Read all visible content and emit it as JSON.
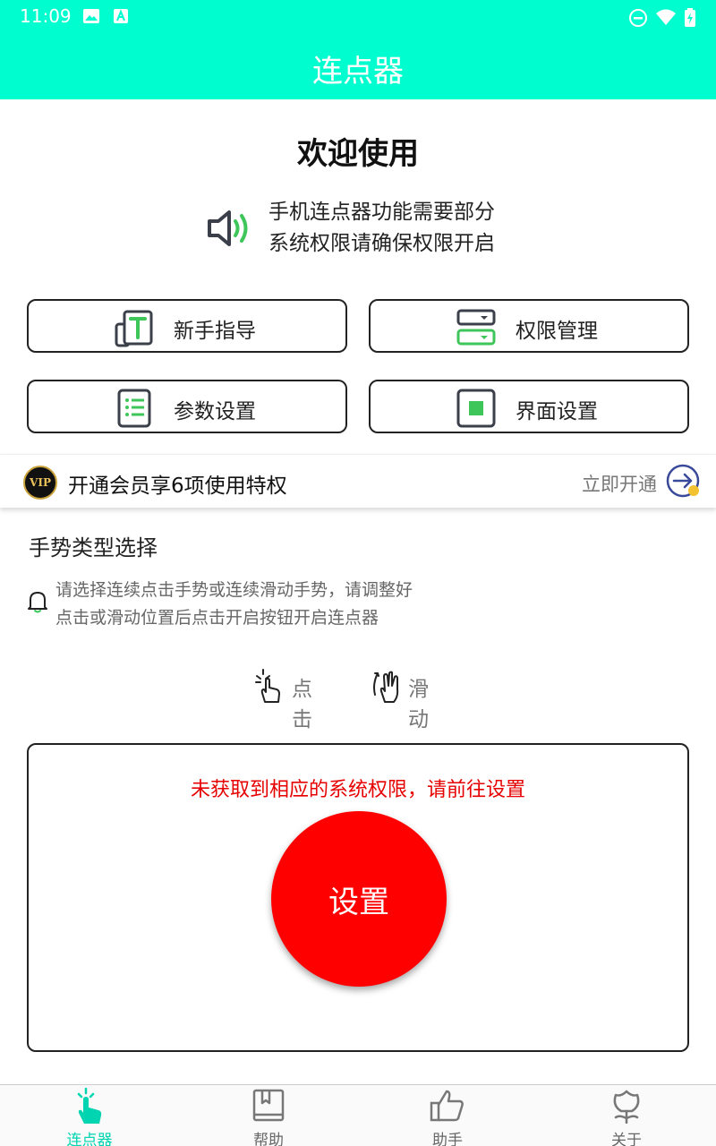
{
  "status_bar": {
    "time": "11:09"
  },
  "header": {
    "title": "连点器"
  },
  "welcome": {
    "title": "欢迎使用",
    "line1": "手机连点器功能需要部分",
    "line2": "系统权限请确保权限开启"
  },
  "functions": [
    {
      "label": "新手指导",
      "icon": "beginner-guide-icon"
    },
    {
      "label": "权限管理",
      "icon": "permission-manage-icon"
    },
    {
      "label": "参数设置",
      "icon": "parameter-settings-icon"
    },
    {
      "label": "界面设置",
      "icon": "interface-settings-icon"
    }
  ],
  "vip": {
    "badge": "VIP",
    "text": "开通会员享6项使用特权",
    "action": "立即开通"
  },
  "gesture": {
    "title": "手势类型选择",
    "tip_line1": "请选择连续点击手势或连续滑动手势，请调整好",
    "tip_line2": "点击或滑动位置后点击开启按钮开启连点器",
    "options": [
      {
        "label": "点击",
        "icon": "tap-hand-icon"
      },
      {
        "label": "滑动",
        "icon": "swipe-hand-icon"
      }
    ]
  },
  "panel": {
    "warning": "未获取到相应的系统权限，请前往设置",
    "button": "设置"
  },
  "bottom_nav": [
    {
      "label": "连点器",
      "icon": "tap-hand-icon",
      "active": true
    },
    {
      "label": "帮助",
      "icon": "book-icon",
      "active": false
    },
    {
      "label": "助手",
      "icon": "thumbs-up-icon",
      "active": false
    },
    {
      "label": "关于",
      "icon": "flower-icon",
      "active": false
    }
  ],
  "colors": {
    "brand": "#00fdcf",
    "accent_green": "#3ec65a",
    "warning_red": "#e60000",
    "button_red": "#ff0000",
    "nav_active": "#00d4b0"
  }
}
